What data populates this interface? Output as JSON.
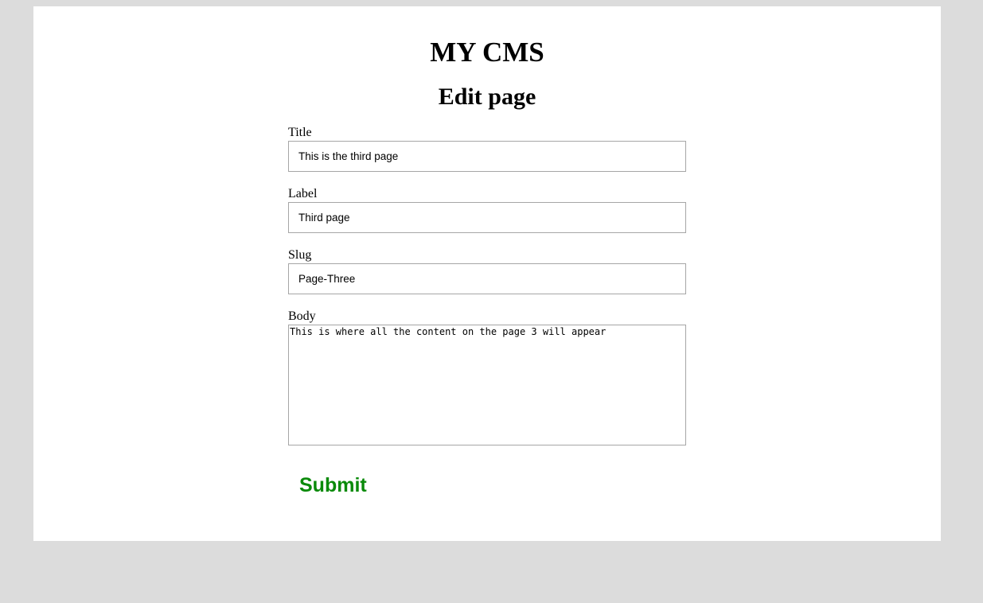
{
  "site": {
    "title": "MY CMS"
  },
  "page": {
    "heading": "Edit page"
  },
  "form": {
    "title": {
      "label": "Title",
      "value": "This is the third page"
    },
    "label": {
      "label": "Label",
      "value": "Third page"
    },
    "slug": {
      "label": "Slug",
      "value": "Page-Three"
    },
    "body": {
      "label": "Body",
      "value": "This is where all the content on the page 3 will appear"
    },
    "submit_label": "Submit"
  },
  "colors": {
    "background": "#dcdcdc",
    "panel": "#ffffff",
    "submit": "#0a8a0a",
    "input_border": "#a6a6a6"
  }
}
